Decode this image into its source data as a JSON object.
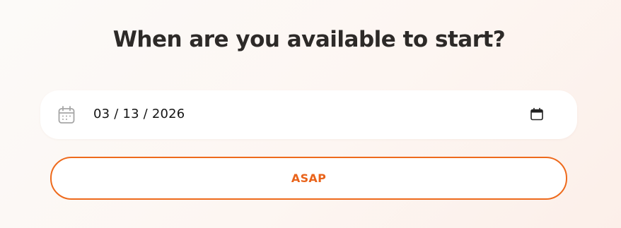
{
  "question": {
    "title": "When are you available to start?"
  },
  "date_field": {
    "value": "03 / 13 / 2026",
    "leading_icon": "calendar-outline-icon",
    "trailing_icon": "calendar-picker-icon"
  },
  "asap_button": {
    "label": "ASAP"
  },
  "colors": {
    "accent": "#ee6a1c",
    "title": "#2d2a28",
    "field_background": "#ffffff",
    "icon_gray": "#a6a6a6"
  }
}
